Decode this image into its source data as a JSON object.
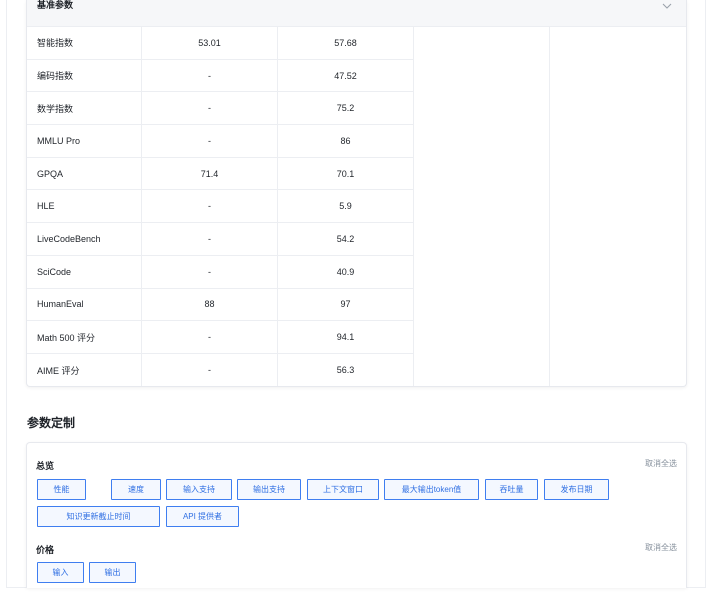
{
  "benchmarks": {
    "section_title": "基准参数",
    "rows": [
      {
        "name": "智能指数",
        "v1": "53.01",
        "v2": "57.68"
      },
      {
        "name": "编码指数",
        "v1": "-",
        "v2": "47.52"
      },
      {
        "name": "数学指数",
        "v1": "-",
        "v2": "75.2"
      },
      {
        "name": "MMLU Pro",
        "v1": "-",
        "v2": "86"
      },
      {
        "name": "GPQA",
        "v1": "71.4",
        "v2": "70.1"
      },
      {
        "name": "HLE",
        "v1": "-",
        "v2": "5.9"
      },
      {
        "name": "LiveCodeBench",
        "v1": "-",
        "v2": "54.2"
      },
      {
        "name": "SciCode",
        "v1": "-",
        "v2": "40.9"
      },
      {
        "name": "HumanEval",
        "v1": "88",
        "v2": "97"
      },
      {
        "name": "Math 500 评分",
        "v1": "-",
        "v2": "94.1"
      },
      {
        "name": "AIME 评分",
        "v1": "-",
        "v2": "56.3"
      }
    ]
  },
  "customize": {
    "title": "参数定制",
    "overview": {
      "label": "总览",
      "deselect_all": "取消全选",
      "chips": [
        "性能",
        "速度",
        "输入支持",
        "输出支持",
        "上下文窗口",
        "最大输出token值",
        "吞吐量",
        "发布日期",
        "知识更新截止时间",
        "API 提供者"
      ]
    },
    "price": {
      "label": "价格",
      "deselect_all": "取消全选",
      "chips": [
        "输入",
        "输出"
      ]
    }
  },
  "colors": {
    "accent": "#2f6fe3",
    "chip_border": "#3f7ef0",
    "chip_bg": "#f4f8ff",
    "muted": "#86909c"
  }
}
